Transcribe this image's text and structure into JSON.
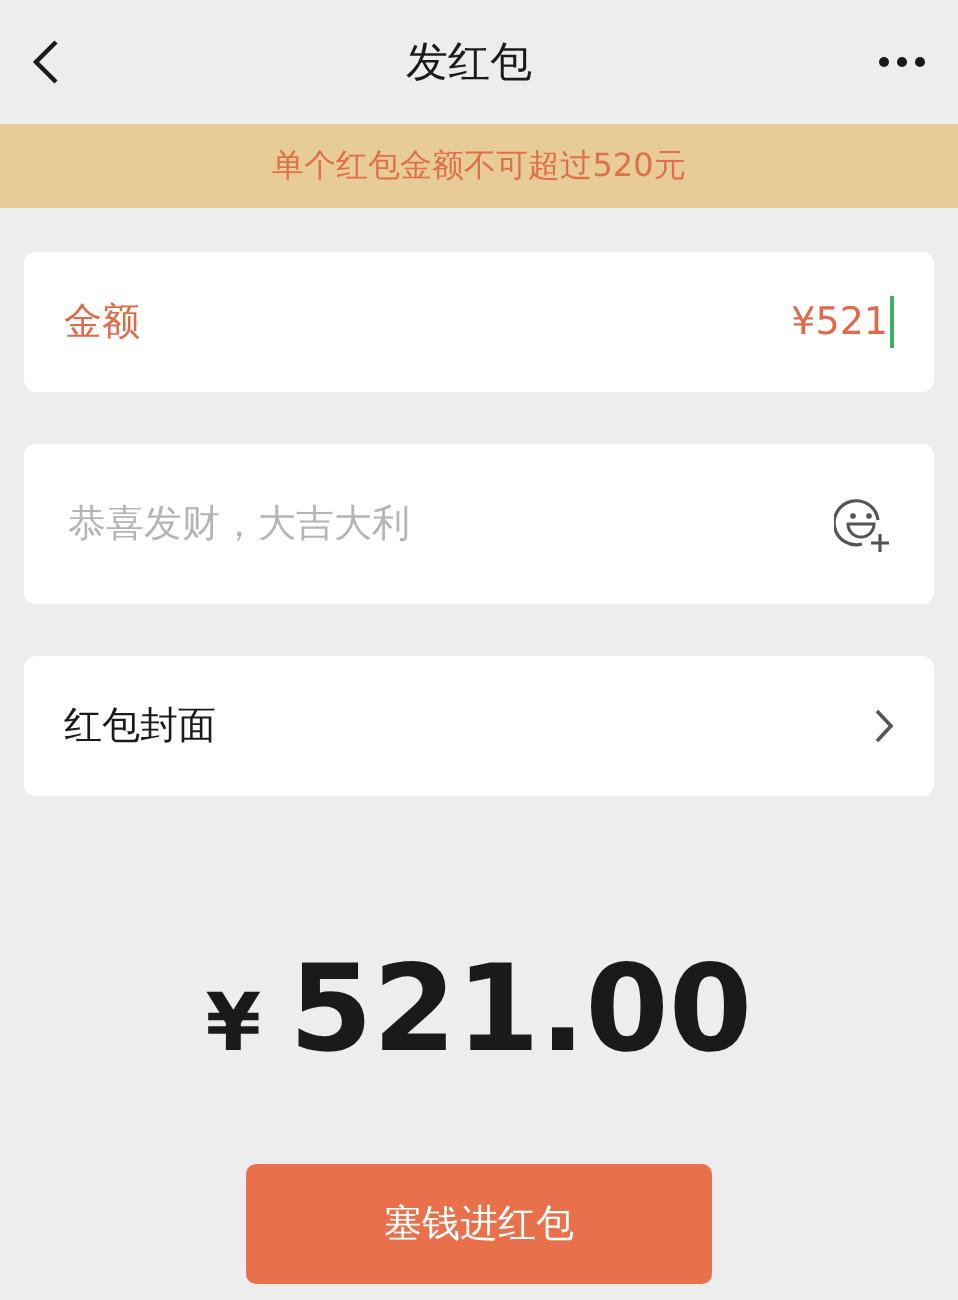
{
  "header": {
    "title": "发红包"
  },
  "notice": {
    "text": "单个红包金额不可超过520元"
  },
  "amount_field": {
    "label": "金额",
    "value": "¥521",
    "error": true
  },
  "greeting_field": {
    "placeholder": "恭喜发财，大吉大利"
  },
  "cover_row": {
    "label": "红包封面"
  },
  "total": {
    "currency": "¥",
    "amount": "521.00"
  },
  "submit_button": {
    "label": "塞钱进红包"
  }
}
